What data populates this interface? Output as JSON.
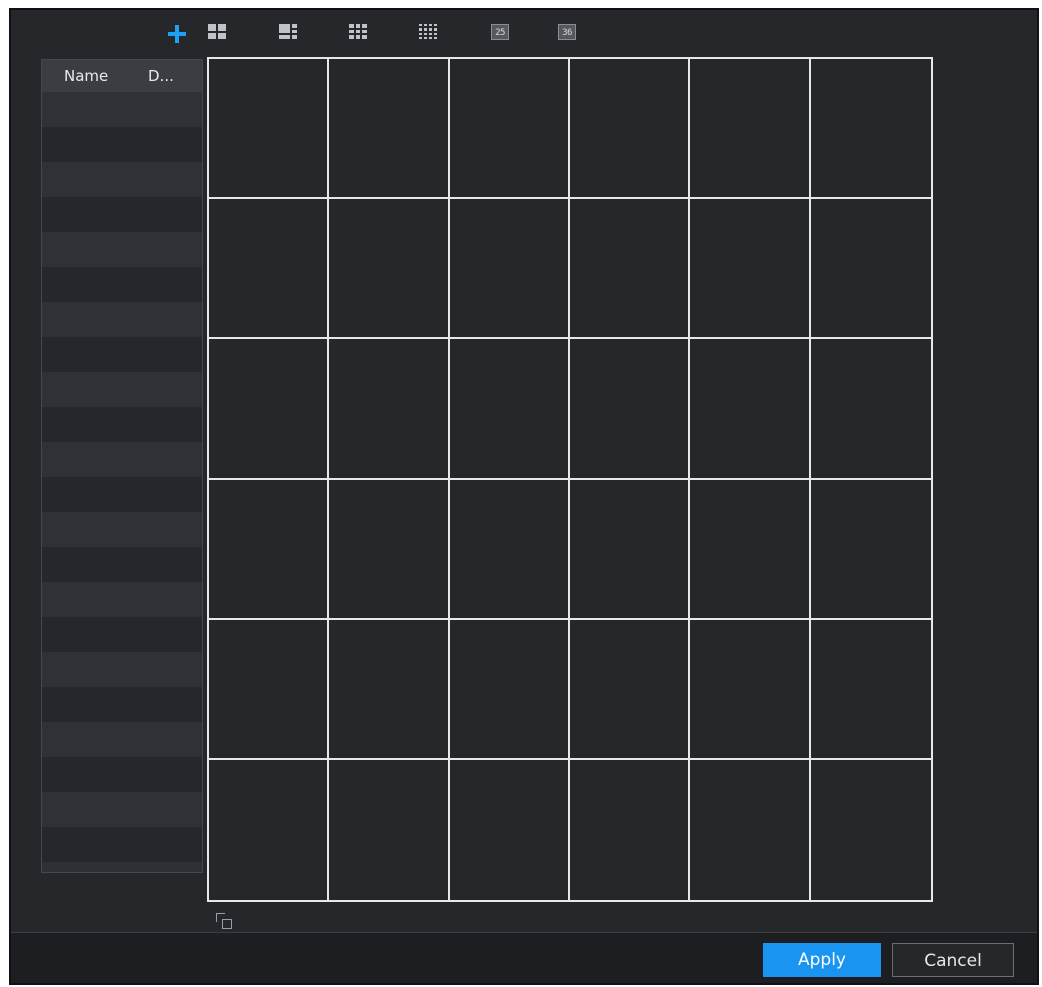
{
  "toolbar": {
    "icons": [
      "plus-icon",
      "layout-4-icon",
      "layout-6-icon",
      "layout-9-icon",
      "layout-16-icon",
      "layout-25-icon",
      "layout-36-icon"
    ],
    "layout_25_label": "25",
    "layout_36_label": "36"
  },
  "device_list": {
    "columns": [
      "Name",
      "D..."
    ],
    "rows": []
  },
  "video_grid": {
    "rows": 6,
    "columns": 6
  },
  "buttons": {
    "apply": "Apply",
    "cancel": "Cancel"
  },
  "colors": {
    "accent": "#1994f0",
    "plus": "#1da1f2",
    "background": "#25272b",
    "grid_lines": "#e8e8e8"
  }
}
